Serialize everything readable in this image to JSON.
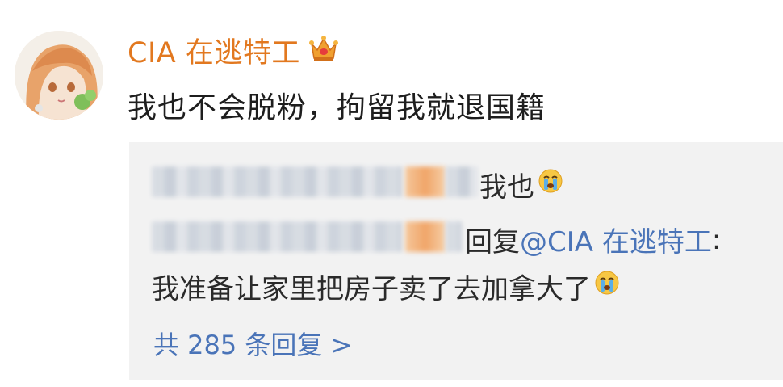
{
  "comment": {
    "username": "CIA 在逃特工",
    "text": "我也不会脱粉，拘留我就退国籍"
  },
  "replies": [
    {
      "text": "我也",
      "emoji": "crying-face-icon"
    },
    {
      "prefix": "回复 ",
      "mention": "@CIA 在逃特工",
      "suffix": ":",
      "text": "我准备让家里把房子卖了去加拿大了",
      "emoji": "crying-face-icon"
    }
  ],
  "more_replies_label": "共 285 条回复 >",
  "colors": {
    "username": "#e2781f",
    "link": "#4a74b8",
    "reply_background": "#f2f2f2"
  }
}
